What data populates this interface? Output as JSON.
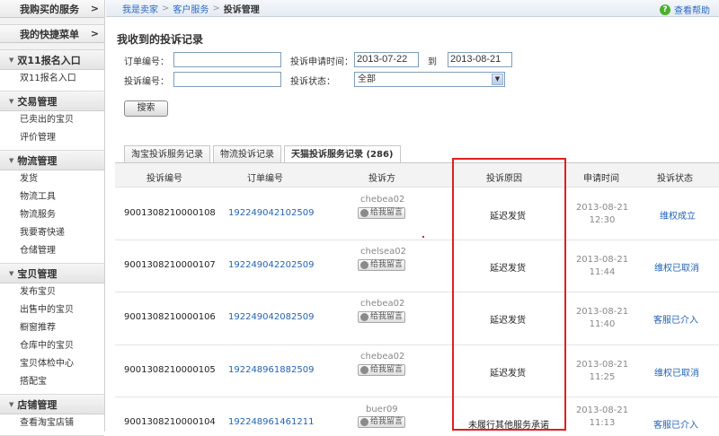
{
  "sidebar": {
    "top1": "我购买的服务",
    "top1_arrow": ">",
    "top2": "我的快捷菜单",
    "top2_arrow": ">",
    "groups": [
      {
        "title": "双11报名入口",
        "items": [
          "双11报名入口"
        ]
      },
      {
        "title": "交易管理",
        "items": [
          "已卖出的宝贝",
          "评价管理"
        ]
      },
      {
        "title": "物流管理",
        "items": [
          "发货",
          "物流工具",
          "物流服务",
          "我要寄快递",
          "仓储管理"
        ]
      },
      {
        "title": "宝贝管理",
        "items": [
          "发布宝贝",
          "出售中的宝贝",
          "橱窗推荐",
          "仓库中的宝贝",
          "宝贝体检中心",
          "搭配宝"
        ]
      },
      {
        "title": "店铺管理",
        "items": [
          "查看淘宝店铺"
        ]
      }
    ]
  },
  "breadcrumb": [
    "我是卖家",
    "客户服务",
    "投诉管理"
  ],
  "breadcrumb_sep": ">",
  "help": {
    "icon": "?",
    "label": "查看帮助"
  },
  "page_title": "我收到的投诉记录",
  "form": {
    "order_label": "订单编号：",
    "order_value": "",
    "complainant_label": "投诉编号：",
    "complainant_value": "",
    "date_label": "投诉申请时间：",
    "date_from": "2013-07-22",
    "date_to_label": "到",
    "date_to": "2013-08-21",
    "status_label": "投诉状态：",
    "status_value": "全部",
    "search_button": "搜索"
  },
  "tabs": [
    "淘宝投诉服务记录",
    "物流投诉记录",
    "天猫投诉服务记录 (286)"
  ],
  "table": {
    "headers": [
      "投诉编号",
      "订单编号",
      "投诉方",
      "投诉原因",
      "申请时间",
      "投诉状态"
    ],
    "msg_label": "给我留言",
    "rows": [
      {
        "id": "9001308210000108",
        "order": "192249042102509",
        "user": "chebea02",
        "reason": "延迟发货",
        "date": "2013-08-21",
        "time": "12:30",
        "status": "维权成立"
      },
      {
        "id": "9001308210000107",
        "order": "192249042202509",
        "user": "chelsea02",
        "reason": "延迟发货",
        "date": "2013-08-21",
        "time": "11:44",
        "status": "维权已取消"
      },
      {
        "id": "9001308210000106",
        "order": "192249042082509",
        "user": "chebea02",
        "reason": "延迟发货",
        "date": "2013-08-21",
        "time": "11:40",
        "status": "客服已介入"
      },
      {
        "id": "9001308210000105",
        "order": "192248961882509",
        "user": "chebea02",
        "reason": "延迟发货",
        "date": "2013-08-21",
        "time": "11:25",
        "status": "维权已取消"
      },
      {
        "id": "9001308210000104",
        "order": "192248961461211",
        "user": "buer09",
        "reason": "未履行其他服务承诺",
        "date": "2013-08-21",
        "time": "11:13",
        "status": "客服已介入"
      }
    ]
  },
  "colors": {
    "link": "#2563b4",
    "highlight_box": "#e02020",
    "help_icon": "#4caf2f"
  }
}
